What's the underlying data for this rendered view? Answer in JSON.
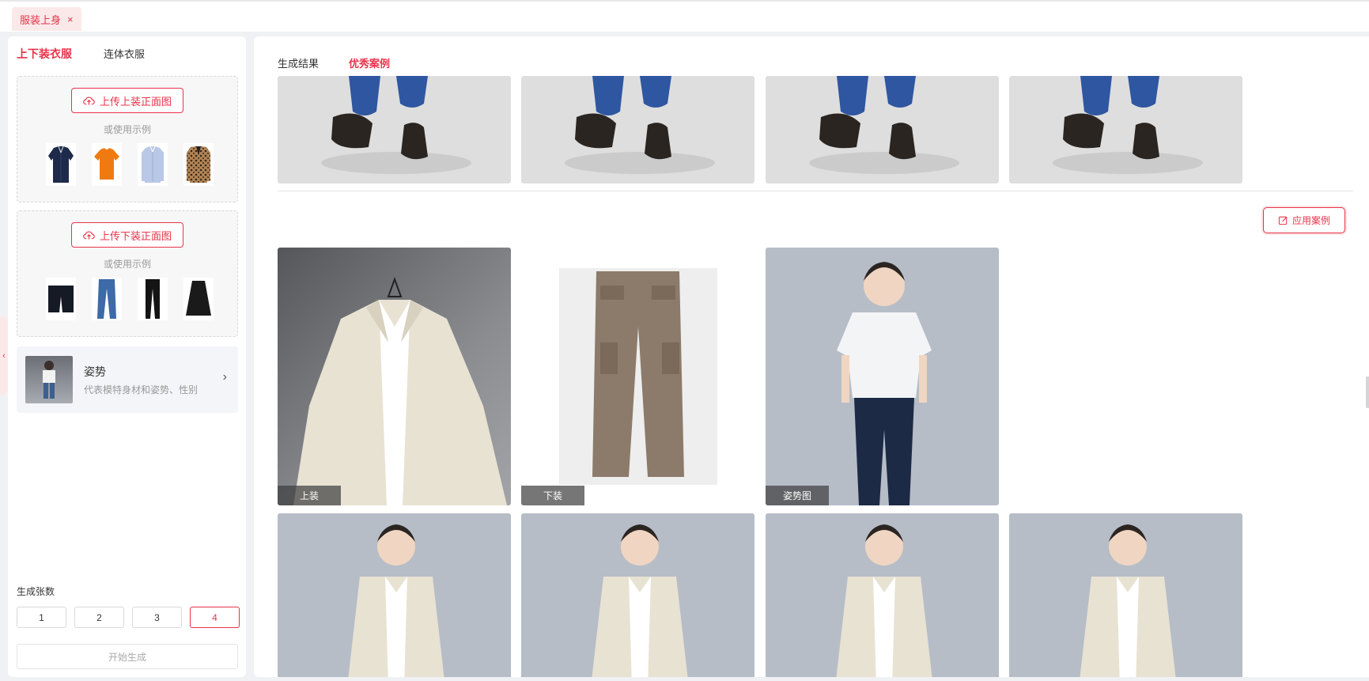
{
  "tab": {
    "label": "服装上身",
    "close": "×"
  },
  "left": {
    "subtabs": [
      "上下装衣服",
      "连体衣服"
    ],
    "top_upload": {
      "button": "上传上装正面图",
      "hint": "或使用示例"
    },
    "bottom_upload": {
      "button": "上传下装正面图",
      "hint": "或使用示例"
    },
    "pose": {
      "title": "姿势",
      "desc": "代表模特身材和姿势、性别"
    },
    "count_label": "生成张数",
    "counts": [
      "1",
      "2",
      "3",
      "4"
    ],
    "selected_count": "4",
    "start": "开始生成"
  },
  "right": {
    "tabs": [
      "生成结果",
      "优秀案例"
    ],
    "apply": "应用案例",
    "captions": {
      "top": "上装",
      "bottom": "下装",
      "pose": "姿势图"
    }
  },
  "colors": {
    "accent": "#e8334a",
    "accent_light": "#fbe9ea"
  },
  "icons": [
    "close-icon",
    "cloud-upload-icon",
    "chevron-right-icon",
    "chevron-left-icon",
    "edit-icon"
  ]
}
